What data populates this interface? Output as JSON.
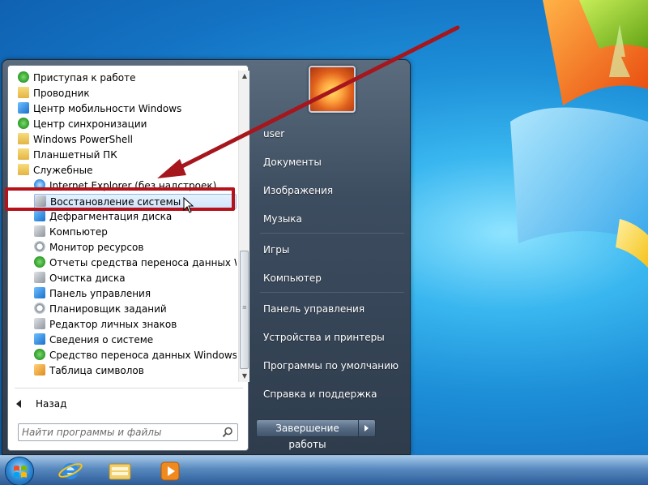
{
  "programs": [
    {
      "label": "Приступая к работе",
      "icon": "getting-started-icon"
    },
    {
      "label": "Проводник",
      "icon": "explorer-icon"
    },
    {
      "label": "Центр мобильности Windows",
      "icon": "mobility-center-icon"
    },
    {
      "label": "Центр синхронизации",
      "icon": "sync-center-icon"
    },
    {
      "label": "Windows PowerShell",
      "icon": "folder-icon"
    },
    {
      "label": "Планшетный ПК",
      "icon": "folder-icon"
    },
    {
      "label": "Служебные",
      "icon": "folder-icon"
    },
    {
      "label": "Internet Explorer (без надстроек)",
      "icon": "ie-icon"
    },
    {
      "label": "Восстановление системы",
      "icon": "system-restore-icon"
    },
    {
      "label": "Дефрагментация диска",
      "icon": "defrag-icon"
    },
    {
      "label": "Компьютер",
      "icon": "computer-icon"
    },
    {
      "label": "Монитор ресурсов",
      "icon": "resource-monitor-icon"
    },
    {
      "label": "Отчеты средства переноса данных Windows",
      "icon": "transfer-reports-icon"
    },
    {
      "label": "Очистка диска",
      "icon": "disk-cleanup-icon"
    },
    {
      "label": "Панель управления",
      "icon": "control-panel-icon"
    },
    {
      "label": "Планировщик заданий",
      "icon": "task-scheduler-icon"
    },
    {
      "label": "Редактор личных знаков",
      "icon": "char-editor-icon"
    },
    {
      "label": "Сведения о системе",
      "icon": "system-info-icon"
    },
    {
      "label": "Средство переноса данных Windows",
      "icon": "easy-transfer-icon"
    },
    {
      "label": "Таблица символов",
      "icon": "char-map-icon"
    }
  ],
  "back_label": "Назад",
  "search": {
    "placeholder": "Найти программы и файлы"
  },
  "places": [
    "user",
    "Документы",
    "Изображения",
    "Музыка",
    "Игры",
    "Компьютер",
    "Панель управления",
    "Устройства и принтеры",
    "Программы по умолчанию",
    "Справка и поддержка"
  ],
  "shutdown_label": "Завершение работы",
  "highlight_color": "#b5121b",
  "taskbar_items": [
    "start-orb",
    "internet-explorer",
    "windows-explorer",
    "media-player"
  ]
}
